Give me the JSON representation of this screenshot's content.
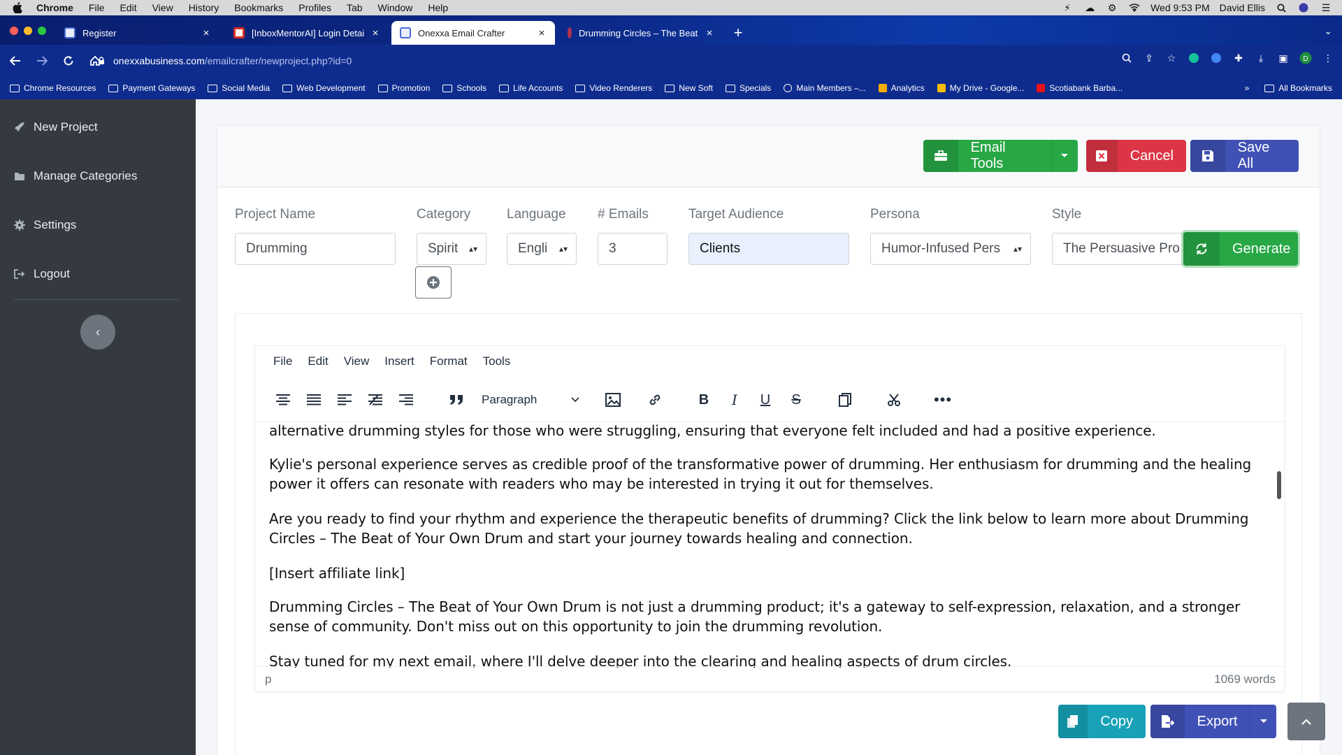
{
  "menubar": {
    "app": "Chrome",
    "items": [
      "File",
      "Edit",
      "View",
      "History",
      "Bookmarks",
      "Profiles",
      "Tab",
      "Window",
      "Help"
    ],
    "clock": "Wed 9:53 PM",
    "user": "David Ellis"
  },
  "tabs": [
    {
      "title": "Register",
      "favicon_color": "#4a6bd6"
    },
    {
      "title": "[InboxMentorAI] Login Details",
      "favicon_color": "#d93025"
    },
    {
      "title": "Onexxa Email Crafter",
      "favicon_color": "#4a6bd6"
    },
    {
      "title": "Drumming Circles – The Beat o",
      "favicon_color": "#b1344d"
    }
  ],
  "address": {
    "host": "onexxabusiness.com",
    "path": "/emailcrafter/newproject.php?id=0"
  },
  "bookmarks": [
    "Chrome Resources",
    "Payment Gateways",
    "Social Media",
    "Web Development",
    "Promotion",
    "Schools",
    "Life Accounts",
    "Video Renderers",
    "New Soft",
    "Specials",
    "Main Members –...",
    "Analytics",
    "My Drive - Google...",
    "Scotiabank Barba..."
  ],
  "bookmarks_all": "All Bookmarks",
  "bookmarks_more": "»",
  "sidebar": {
    "items": [
      {
        "label": "New Project",
        "icon": "rocket-icon"
      },
      {
        "label": "Manage Categories",
        "icon": "folder-icon"
      },
      {
        "label": "Settings",
        "icon": "gear-icon"
      },
      {
        "label": "Logout",
        "icon": "logout-icon"
      }
    ],
    "collapse": "‹"
  },
  "header": {
    "email_tools": "Email Tools",
    "cancel": "Cancel",
    "save_all": "Save All"
  },
  "form": {
    "project_name": {
      "label": "Project Name",
      "value": "Drumming"
    },
    "category": {
      "label": "Category",
      "value": "Spirit"
    },
    "language": {
      "label": "Language",
      "value": "Engli"
    },
    "emails": {
      "label": "# Emails",
      "value": "3"
    },
    "audience": {
      "label": "Target Audience",
      "value": "Clients"
    },
    "persona": {
      "label": "Persona",
      "value": "Humor-Infused Pers"
    },
    "style": {
      "label": "Style",
      "value": "The Persuasive Pro"
    },
    "generate": "Generate"
  },
  "editor": {
    "menu": [
      "File",
      "Edit",
      "View",
      "Insert",
      "Format",
      "Tools"
    ],
    "block_format": "Paragraph",
    "paragraphs": [
      "alternative drumming styles for those who were struggling, ensuring that everyone felt included and had a positive experience.",
      "Kylie's personal experience serves as credible proof of the transformative power of drumming. Her enthusiasm for drumming and the healing power it offers can resonate with readers who may be interested in trying it out for themselves.",
      "Are you ready to find your rhythm and experience the therapeutic benefits of drumming? Click the link below to learn more about Drumming Circles – The Beat of Your Own Drum and start your journey towards healing and connection.",
      "[Insert affiliate link]",
      "Drumming Circles – The Beat of Your Own Drum is not just a drumming product; it's a gateway to self-expression, relaxation, and a stronger sense of community. Don't miss out on this opportunity to join the drumming revolution.",
      "Stay tuned for my next email, where I'll delve deeper into the clearing and healing aspects of drum circles."
    ],
    "path": "p",
    "word_count": "1069 words"
  },
  "footer": {
    "copy": "Copy",
    "export": "Export"
  }
}
